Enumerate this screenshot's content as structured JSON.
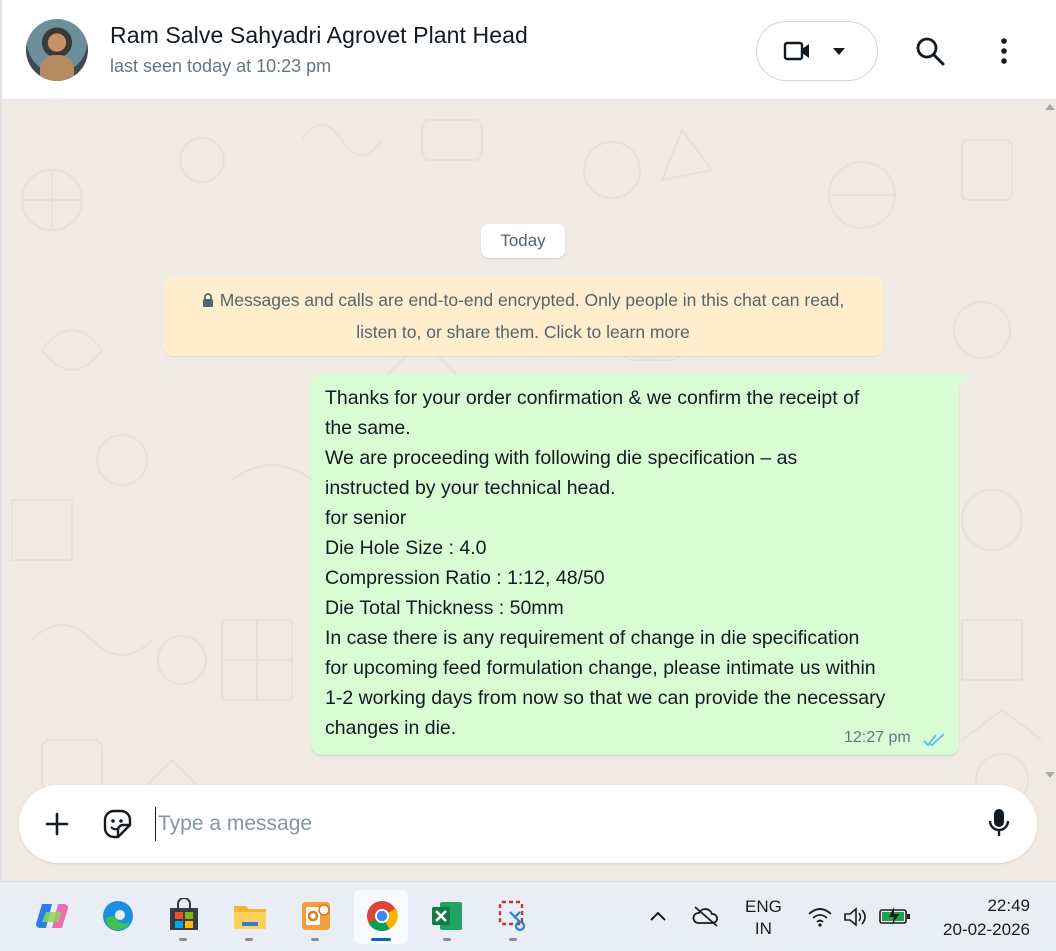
{
  "header": {
    "contact_name": "Ram Salve Sahyadri Agrovet Plant Head",
    "last_seen": "last seen today at 10:23 pm",
    "icons": {
      "video": "video-camera-icon",
      "dropdown": "caret-down-icon",
      "search": "search-icon",
      "menu": "more-vertical-icon"
    }
  },
  "chat": {
    "date_chip": "Today",
    "encryption_notice": {
      "line1": "Messages and calls are end-to-end encrypted. Only people in this chat can read,",
      "line2": "listen to, or share them. Click to learn more"
    },
    "message": {
      "lines": [
        "Thanks for your order confirmation & we confirm the receipt of",
        "the same.",
        "We are proceeding with following die specification –  as",
        "instructed by your technical head.",
        "for senior",
        "Die Hole Size : 4.0",
        "Compression Ratio : 1:12, 48/50",
        "Die Total Thickness : 50mm",
        "In case there is any requirement of change in die specification",
        "for upcoming feed formulation change, please intimate us within",
        "1-2 working days from now so that we can provide the necessary",
        "changes in die."
      ],
      "time": "12:27 pm",
      "status": "read",
      "tick_color": "#53bdeb"
    }
  },
  "composer": {
    "placeholder": "Type a message",
    "value": "",
    "icons": {
      "attach": "plus-icon",
      "sticker": "sticker-icon",
      "mic": "microphone-icon"
    }
  },
  "taskbar": {
    "apps": [
      "copilot-icon",
      "edge-icon",
      "store-icon",
      "file-explorer-icon",
      "outlook-icon",
      "chrome-icon",
      "excel-icon",
      "snipping-tool-icon"
    ],
    "active_app": "chrome-icon",
    "language": {
      "line1": "ENG",
      "line2": "IN"
    },
    "time": "22:49",
    "date": "20-02-2026"
  },
  "colors": {
    "chat_bg": "#efeae2",
    "outgoing_bubble": "#d9fdd3",
    "notice_bg": "#ffeecd",
    "accent_blue": "#53bdeb"
  }
}
